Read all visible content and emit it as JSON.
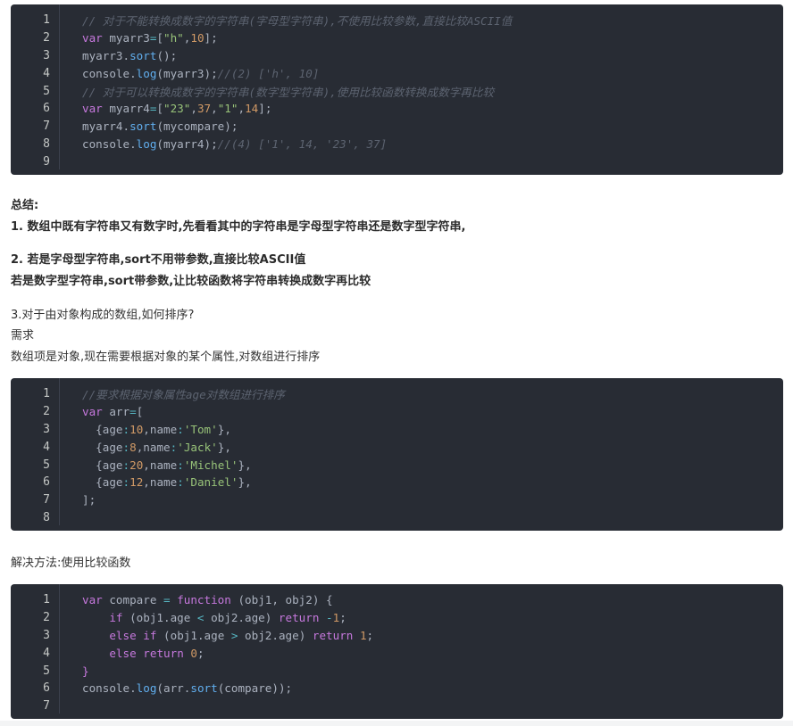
{
  "block1": {
    "line_numbers": [
      "1",
      "2",
      "3",
      "4",
      "5",
      "6",
      "7",
      "8",
      "9"
    ],
    "l1_comment": "// 对于不能转换成数字的字符串(字母型字符串),不使用比较参数,直接比较ASCII值",
    "l2": {
      "kw": "var",
      "name": " myarr3",
      "eq": "=",
      "b1": "[",
      "s1": "\"h\"",
      "comma": ",",
      "n1": "10",
      "b2": "];"
    },
    "l3": {
      "obj": "myarr3",
      "dot": ".",
      "fn": "sort",
      "rest": "();"
    },
    "l4": {
      "obj": "console",
      "dot": ".",
      "fn": "log",
      "rest": "(myarr3);",
      "comment": "//(2) ['h', 10]"
    },
    "l5_comment": "// 对于可以转换成数字的字符串(数字型字符串),使用比较函数转换成数字再比较",
    "l6": {
      "kw": "var",
      "name": " myarr4",
      "eq": "=",
      "b1": "[",
      "s1": "\"23\"",
      "c1": ",",
      "n1": "37",
      "c2": ",",
      "s2": "\"1\"",
      "c3": ",",
      "n2": "14",
      "b2": "];"
    },
    "l7": {
      "obj": "myarr4",
      "dot": ".",
      "fn": "sort",
      "rest": "(mycompare);"
    },
    "l8": {
      "obj": "console",
      "dot": ".",
      "fn": "log",
      "rest": "(myarr4);",
      "comment": "//(4) ['1', 14, '23', 37]"
    }
  },
  "summary": {
    "heading": "总结:",
    "p1": "1. 数组中既有字符串又有数字时,先看看其中的字符串是字母型字符串还是数字型字符串,",
    "p2": "2. 若是字母型字符串,sort不用带参数,直接比较ASCII值",
    "p3": "若是数字型字符串,sort带参数,让比较函数将字符串转换成数字再比较"
  },
  "section3": {
    "title": "3.对于由对象构成的数组,如何排序?",
    "need": "需求",
    "desc": "数组项是对象,现在需要根据对象的某个属性,对数组进行排序"
  },
  "block2": {
    "line_numbers": [
      "1",
      "2",
      "3",
      "4",
      "5",
      "6",
      "7",
      "8"
    ],
    "l1_comment": "//要求根据对象属性age对数组进行排序",
    "l2": {
      "kw": "var",
      "name": " arr",
      "eq": "=",
      "b": "["
    },
    "items": [
      {
        "open": "{",
        "k1": "age",
        "c1": ":",
        "v1": "10",
        "sep": ",",
        "k2": "name",
        "c2": ":",
        "v2": "'Tom'",
        "close": "},"
      },
      {
        "open": "{",
        "k1": "age",
        "c1": ":",
        "v1": "8",
        "sep": ",",
        "k2": "name",
        "c2": ":",
        "v2": "'Jack'",
        "close": "},"
      },
      {
        "open": "{",
        "k1": "age",
        "c1": ":",
        "v1": "20",
        "sep": ",",
        "k2": "name",
        "c2": ":",
        "v2": "'Michel'",
        "close": "},"
      },
      {
        "open": "{",
        "k1": "age",
        "c1": ":",
        "v1": "12",
        "sep": ",",
        "k2": "name",
        "c2": ":",
        "v2": "'Daniel'",
        "close": "},"
      }
    ],
    "l7": "];"
  },
  "solution": {
    "text": "解决方法:使用比较函数"
  },
  "block3": {
    "line_numbers": [
      "1",
      "2",
      "3",
      "4",
      "5",
      "6",
      "7"
    ],
    "l1": {
      "kw": "var",
      "name": " compare ",
      "eq": "=",
      "sp": " ",
      "fnkw": "function",
      "rest": " (obj1, obj2) {"
    },
    "l2": {
      "kw": "if",
      "a": " (obj1.age ",
      "op": "<",
      "b": " obj2.age) ",
      "ret": "return",
      "sp": " ",
      "op2": "-",
      "num": "1",
      "end": ";"
    },
    "l3": {
      "kw": "else",
      "sp": " ",
      "kw2": "if",
      "a": " (obj1.age ",
      "op": ">",
      "b": " obj2.age) ",
      "ret": "return",
      "sp2": " ",
      "num": "1",
      "end": ";"
    },
    "l4": {
      "kw": "else",
      "sp": " ",
      "ret": "return",
      "sp2": " ",
      "num": "0",
      "end": ";"
    },
    "l5": "}",
    "l6": {
      "obj": "console",
      "dot": ".",
      "fn": "log",
      "p1": "(arr",
      "dot2": ".",
      "fn2": "sort",
      "rest": "(compare));"
    }
  }
}
